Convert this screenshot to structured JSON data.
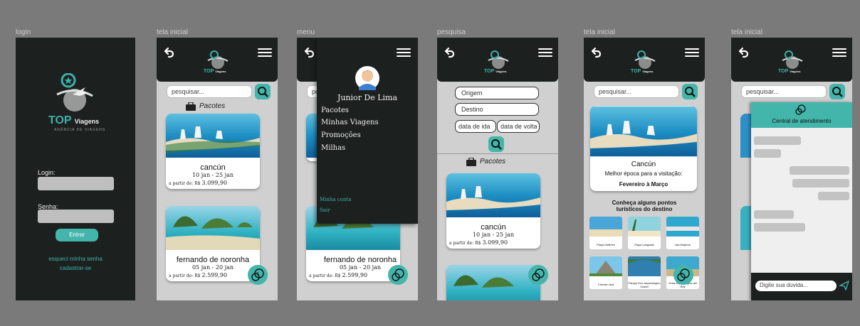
{
  "frames": {
    "login": {
      "label": "login",
      "brand_top": "TOP",
      "brand_rest": "Viagens",
      "brand_tagline": "AGÊNCIA DE VIAGENS",
      "login_label": "Login:",
      "password_label": "Senha:",
      "enter_button": "Entrar",
      "forgot_link": "esqueci minha senha",
      "register_link": "cadastrar-se"
    },
    "home": {
      "label": "tela inicial",
      "search_placeholder": "pesquisar...",
      "section_title": "Pacotes",
      "packages": [
        {
          "name": "cancún",
          "dates": "10 jan - 25 jan",
          "price_prefix": "a partir de: R$",
          "price": "3.099,90"
        },
        {
          "name": "fernando de noronha",
          "dates": "05 jan - 20 jan",
          "price_prefix": "a partir de: R$",
          "price": "2.599,90"
        }
      ]
    },
    "menu": {
      "label": "menu",
      "user_name": "Junior De Lima",
      "items": [
        "Pacotes",
        "Minhas Viagens",
        "Promoções",
        "Milhas"
      ],
      "footer_items": [
        "Minha conta",
        "Sair"
      ]
    },
    "search": {
      "label": "pesquisa",
      "origin": "Origem",
      "destination": "Destino",
      "departure": "data de ida",
      "return": "data de volta",
      "section_title": "Pacotes"
    },
    "detail": {
      "label": "tela inicial",
      "search_placeholder": "pesquisar...",
      "city": "Cancún",
      "best_time_label": "Melhor época para a visitação:",
      "best_time_value": "Fevereiro à Março",
      "spots_title": "Conheça alguns pontos turísticos do destino",
      "spots": [
        "Playa Delfines",
        "Playa Langosta",
        "Isla Mujeres",
        "Chichén Itzá",
        "Parque Eco-arqueológico Xcaret",
        "Zona Arqueológica del Rey"
      ]
    },
    "support": {
      "label": "tela inicial",
      "search_placeholder": "pesquisar...",
      "panel_title": "Central de atendimento",
      "input_placeholder": "Digite sua duvida..."
    }
  },
  "colors": {
    "dark": "#1c2120",
    "accent": "#43b5ab",
    "bg": "#7a7a7a"
  }
}
